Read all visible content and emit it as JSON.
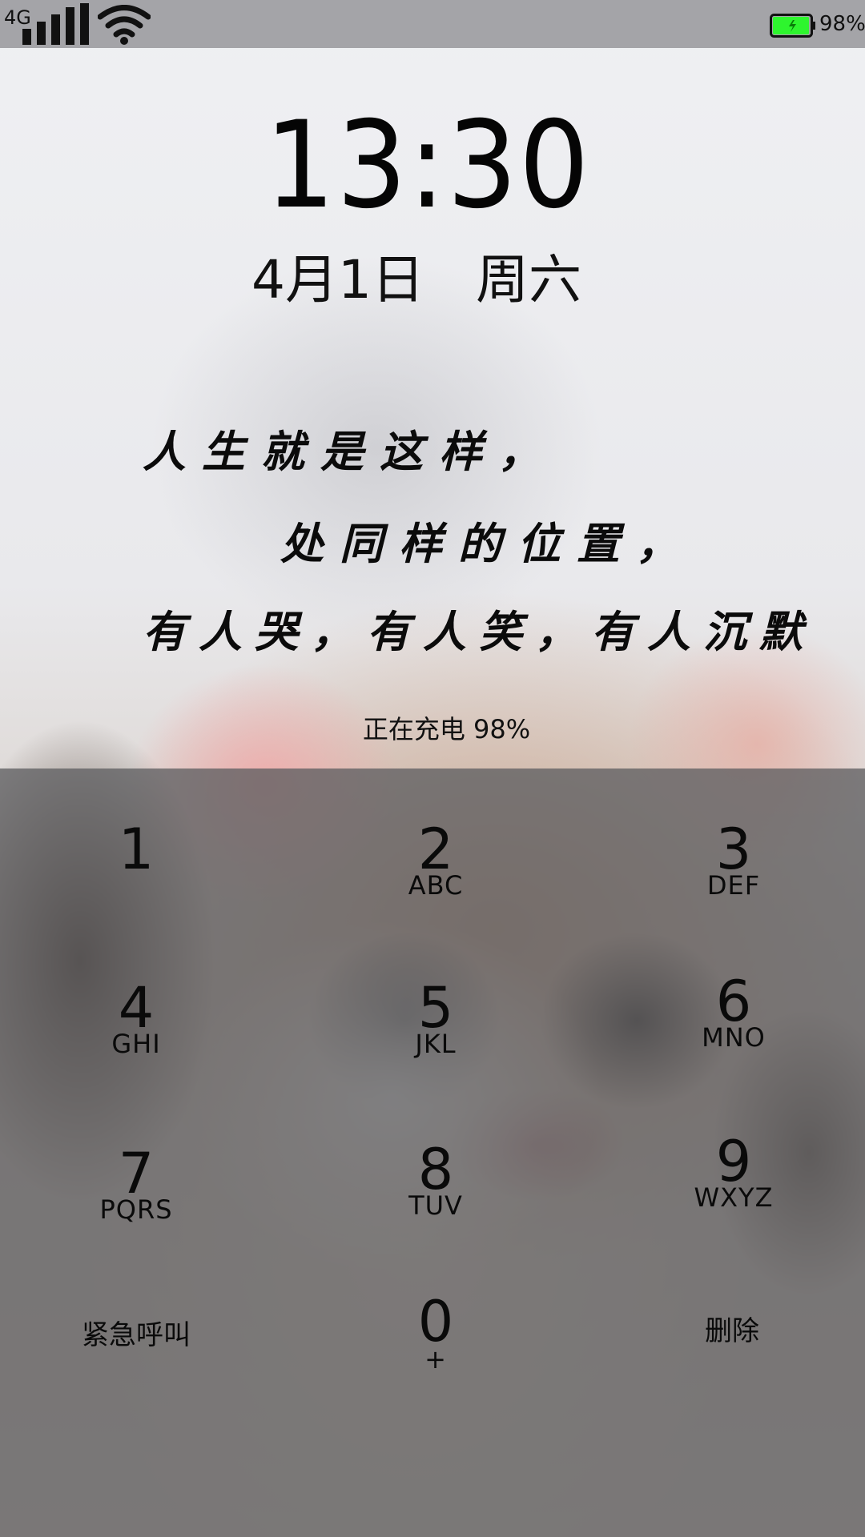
{
  "status_bar": {
    "network_type": "4G",
    "signal_icon": "signal-bars-icon",
    "wifi_icon": "wifi-icon",
    "battery_icon": "battery-charging-icon",
    "battery_level": 0.98,
    "battery_color": "#2ef52e",
    "battery_text": "98%"
  },
  "lock_screen": {
    "time": "13:30",
    "date": "4月1日",
    "weekday": "周六",
    "quote": [
      "人生就是这样，",
      "处同样的位置，",
      "有人哭，有人笑，有人沉默"
    ],
    "charging_text": "正在充电 98%"
  },
  "keypad": {
    "keys": [
      {
        "digit": "1",
        "letters": ""
      },
      {
        "digit": "2",
        "letters": "ABC"
      },
      {
        "digit": "3",
        "letters": "DEF"
      },
      {
        "digit": "4",
        "letters": "GHI"
      },
      {
        "digit": "5",
        "letters": "JKL"
      },
      {
        "digit": "6",
        "letters": "MNO"
      },
      {
        "digit": "7",
        "letters": "PQRS"
      },
      {
        "digit": "8",
        "letters": "TUV"
      },
      {
        "digit": "9",
        "letters": "WXYZ"
      },
      {
        "digit": "0",
        "letters": "+"
      }
    ],
    "emergency_label": "紧急呼叫",
    "delete_label": "删除"
  }
}
